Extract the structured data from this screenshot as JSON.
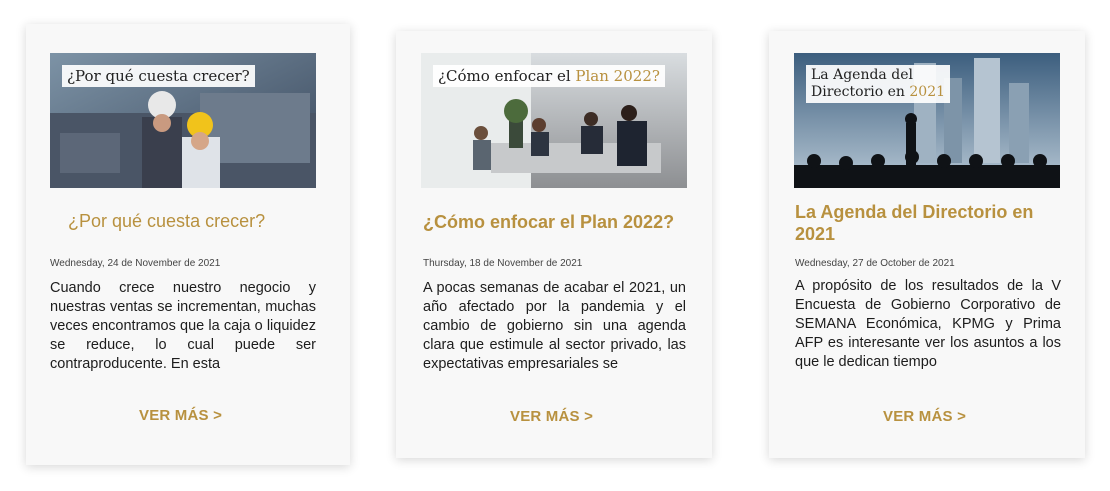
{
  "colors": {
    "accent": "#b8913f",
    "card_bg": "#f8f8f8",
    "text": "#1d1d1d"
  },
  "cards": [
    {
      "image_overlay": "¿Por qué cuesta crecer?",
      "title": "¿Por qué cuesta crecer?",
      "date": "Wednesday, 24 de November de 2021",
      "excerpt": "Cuando crece nuestro negocio y nuestras ventas se incrementan, muchas veces encontramos que la caja o liquidez se reduce, lo cual puede ser contraproducente. En esta",
      "more_label": "VER MÁS >"
    },
    {
      "image_overlay_prefix": "¿Cómo enfocar el ",
      "image_overlay_highlight": "Plan 2022?",
      "title": "¿Cómo enfocar el Plan 2022?",
      "date": "Thursday, 18 de November de 2021",
      "excerpt": "A pocas semanas de acabar el 2021, un año afectado por la pandemia y el cambio de gobierno sin una agenda clara que estimule al sector privado, las expectativas empresariales se",
      "more_label": "VER MÁS >"
    },
    {
      "image_overlay_line1": "La Agenda del",
      "image_overlay_line2_prefix": "Directorio en ",
      "image_overlay_line2_highlight": "2021",
      "title": "La Agenda del Directorio en 2021",
      "date": "Wednesday, 27 de October de 2021",
      "excerpt": "A propósito de los resultados de la V Encuesta de Gobierno Corporativo de SEMANA Económica, KPMG y Prima AFP es interesante ver los asuntos a los que le dedican tiempo",
      "more_label": "VER MÁS >"
    }
  ]
}
